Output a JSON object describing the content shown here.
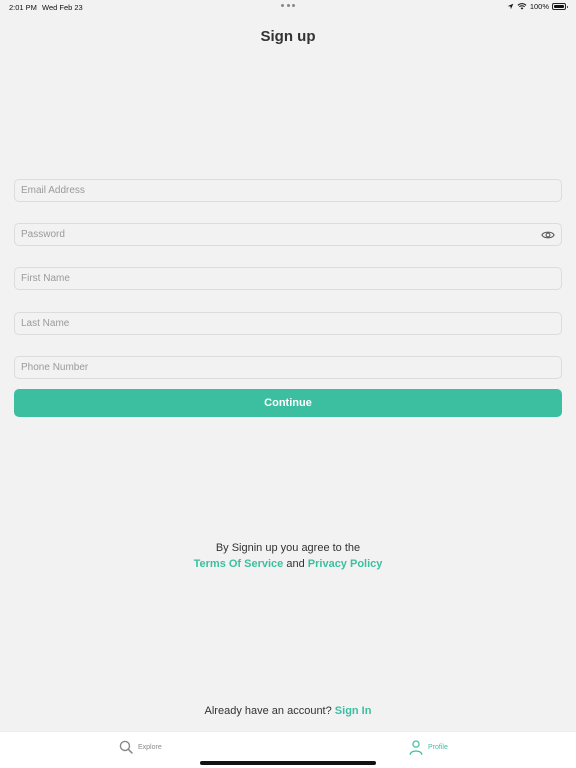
{
  "status_bar": {
    "time": "2:01 PM",
    "date": "Wed Feb 23",
    "battery": "100%"
  },
  "page": {
    "title": "Sign up"
  },
  "form": {
    "email_placeholder": "Email Address",
    "password_placeholder": "Password",
    "first_name_placeholder": "First Name",
    "last_name_placeholder": "Last Name",
    "phone_placeholder": "Phone Number",
    "continue_label": "Continue"
  },
  "agreement": {
    "line1": "By Signin up you agree to the",
    "terms": "Terms Of Service",
    "and": "and",
    "privacy": "Privacy Policy"
  },
  "signin": {
    "prompt": "Already have an account?",
    "link": "Sign In"
  },
  "tab_bar": {
    "items": [
      {
        "label": "Explore",
        "icon": "search-icon",
        "active": false
      },
      {
        "label": "Profile",
        "icon": "person-icon",
        "active": true
      }
    ]
  },
  "colors": {
    "accent": "#3cbfa0",
    "background": "#f2f2f2",
    "text": "#333333",
    "placeholder": "#9a9a9a"
  }
}
